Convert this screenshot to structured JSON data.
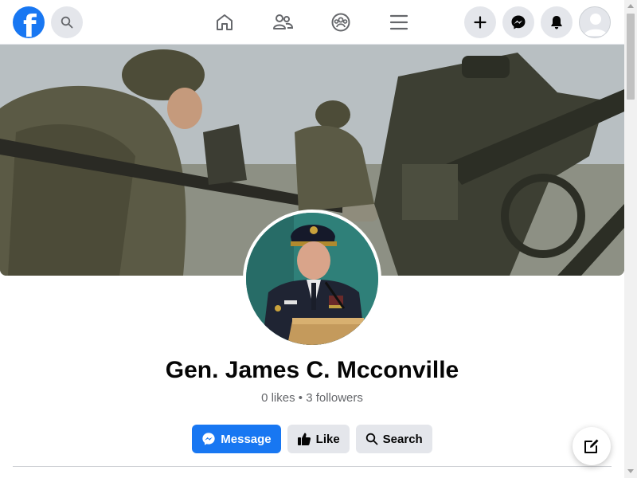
{
  "header": {
    "logo_icon": "facebook-logo-icon",
    "search_icon": "search-icon",
    "nav": [
      {
        "icon": "home-icon"
      },
      {
        "icon": "friends-icon"
      },
      {
        "icon": "groups-icon"
      },
      {
        "icon": "menu-icon"
      }
    ],
    "right": [
      {
        "icon": "plus-icon"
      },
      {
        "icon": "messenger-icon"
      },
      {
        "icon": "bell-icon"
      },
      {
        "icon": "avatar-icon"
      }
    ]
  },
  "profile": {
    "name": "Gen. James C. Mcconville",
    "stats": "0 likes • 3 followers"
  },
  "actions": {
    "message_label": "Message",
    "like_label": "Like",
    "search_label": "Search"
  },
  "colors": {
    "brand": "#1877f2",
    "button_secondary": "#e4e6eb",
    "text_primary": "#050505",
    "text_secondary": "#65676b"
  }
}
